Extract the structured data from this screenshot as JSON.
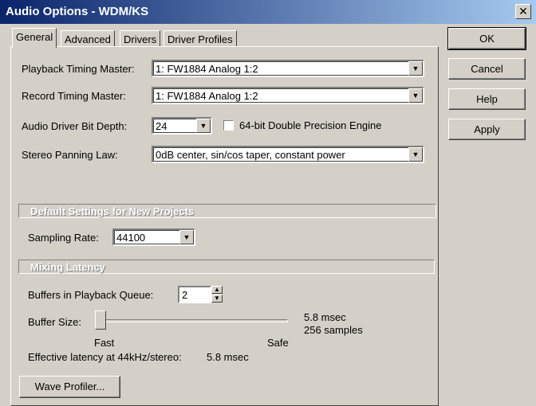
{
  "window": {
    "title": "Audio Options - WDM/KS",
    "close_glyph": "✕"
  },
  "tabs": [
    {
      "label": "General"
    },
    {
      "label": "Advanced"
    },
    {
      "label": "Drivers"
    },
    {
      "label": "Driver Profiles"
    }
  ],
  "general": {
    "playback_timing_label": "Playback Timing Master:",
    "playback_timing_value": "1: FW1884 Analog 1:2",
    "record_timing_label": "Record Timing Master:",
    "record_timing_value": "1: FW1884 Analog 1:2",
    "bit_depth_label": "Audio Driver Bit Depth:",
    "bit_depth_value": "24",
    "double_precision_label": "64-bit Double Precision Engine",
    "double_precision_checked": false,
    "panning_label": "Stereo Panning Law:",
    "panning_value": "0dB center, sin/cos taper, constant power"
  },
  "defaults": {
    "heading": "Default Settings for New Projects",
    "sampling_rate_label": "Sampling Rate:",
    "sampling_rate_value": "44100"
  },
  "latency": {
    "heading": "Mixing Latency",
    "buffers_label": "Buffers in Playback Queue:",
    "buffers_value": "2",
    "buffer_size_label": "Buffer Size:",
    "buffer_size_fraction": 0.0,
    "fast_label": "Fast",
    "safe_label": "Safe",
    "buffer_msec": "5.8 msec",
    "buffer_samples": "256 samples",
    "effective_label": "Effective latency at 44kHz/stereo:",
    "effective_value": "5.8 msec"
  },
  "buttons": {
    "ok": "OK",
    "cancel": "Cancel",
    "help": "Help",
    "apply": "Apply",
    "wave_profiler": "Wave Profiler..."
  },
  "colors": {
    "title_gradient_start": "#0a246a",
    "title_gradient_end": "#a6caf0",
    "dialog_face": "#d4d0c8"
  }
}
